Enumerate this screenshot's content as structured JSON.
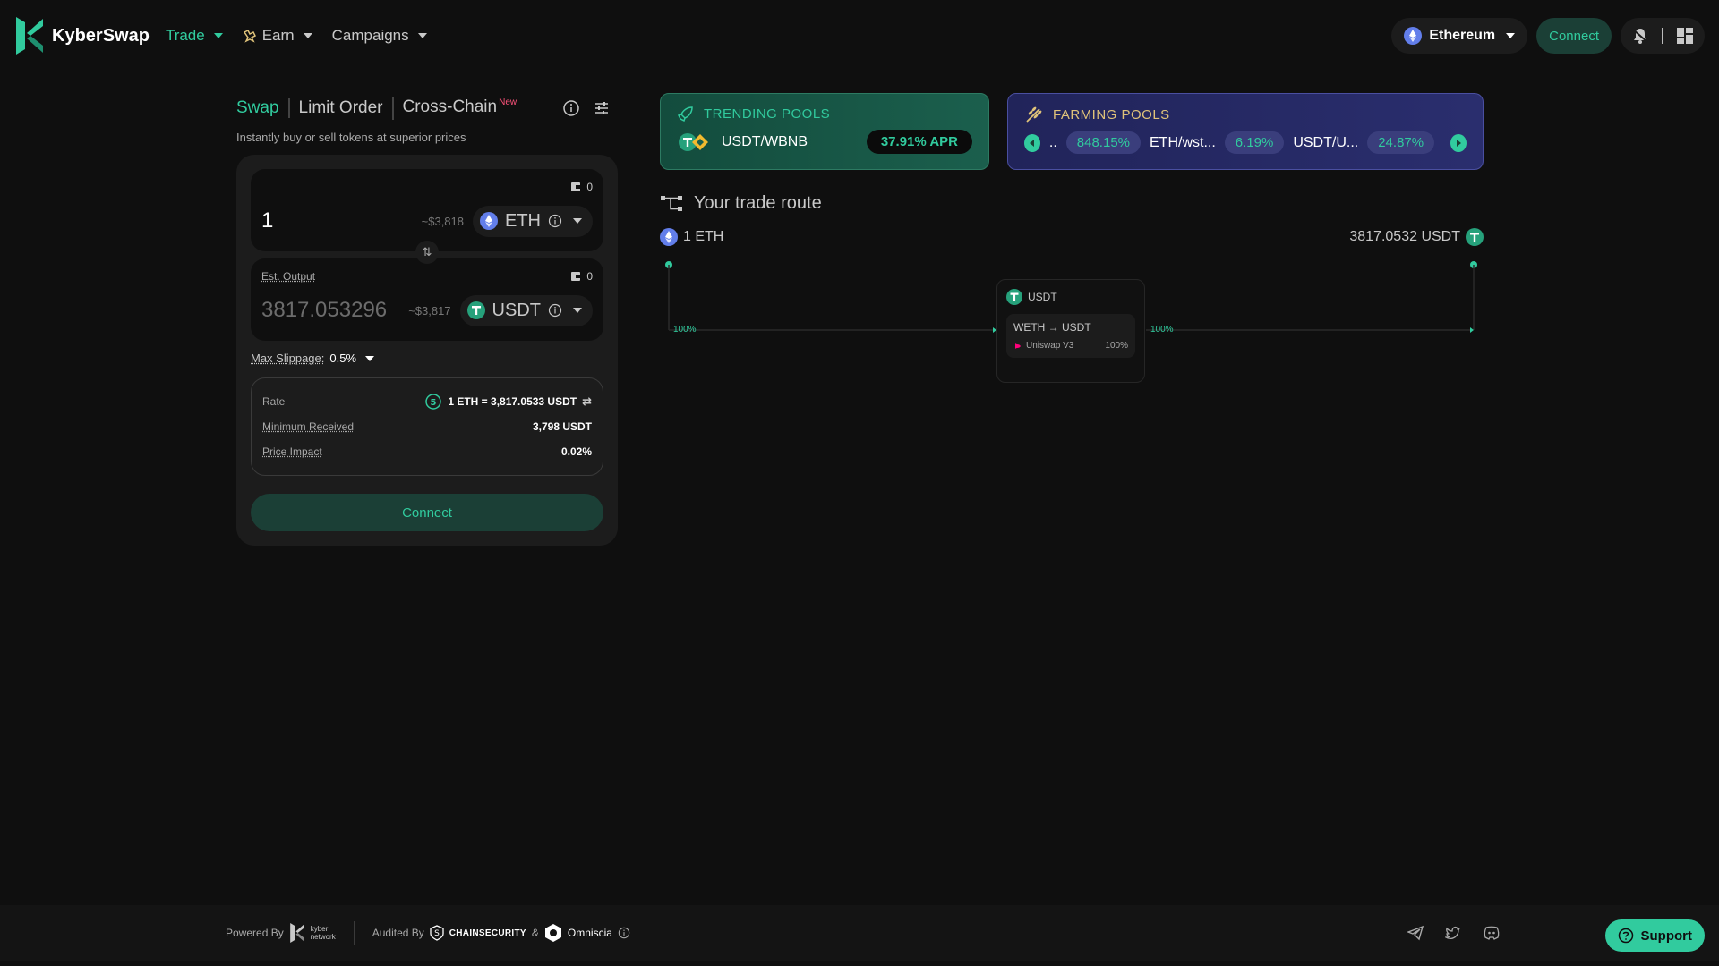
{
  "brand": {
    "name": "KyberSwap"
  },
  "nav": {
    "items": [
      {
        "label": "Trade",
        "active": true
      },
      {
        "label": "Earn",
        "active": false
      },
      {
        "label": "Campaigns",
        "active": false
      }
    ]
  },
  "header": {
    "network": "Ethereum",
    "connect_label": "Connect"
  },
  "swap": {
    "tabs": [
      {
        "label": "Swap",
        "active": true
      },
      {
        "label": "Limit Order",
        "active": false
      },
      {
        "label": "Cross-Chain",
        "active": false,
        "badge": "New"
      }
    ],
    "subtitle": "Instantly buy or sell tokens at superior prices",
    "input": {
      "balance": "0",
      "amount": "1",
      "usd": "~$3,818",
      "token": "ETH"
    },
    "output": {
      "label": "Est. Output",
      "balance": "0",
      "amount": "3817.053296",
      "usd": "~$3,817",
      "token": "USDT"
    },
    "slippage": {
      "label": "Max Slippage:",
      "value": "0.5%"
    },
    "info": {
      "rate_label": "Rate",
      "rate_countdown": "5",
      "rate_value": "1 ETH = 3,817.0533 USDT",
      "min_label": "Minimum Received",
      "min_value": "3,798 USDT",
      "impact_label": "Price Impact",
      "impact_value": "0.02%"
    },
    "connect_label": "Connect"
  },
  "trending": {
    "title": "TRENDING POOLS",
    "pair": "USDT/WBNB",
    "apr": "37.91% APR"
  },
  "farming": {
    "title": "FARMING POOLS",
    "items": [
      {
        "name": "..",
        "apr": "848.15%"
      },
      {
        "name": "ETH/wst...",
        "apr": "6.19%"
      },
      {
        "name": "USDT/U...",
        "apr": "24.87%"
      }
    ]
  },
  "route": {
    "title": "Your trade route",
    "from": "1 ETH",
    "to": "3817.0532 USDT",
    "left_pct": "100%",
    "right_pct": "100%",
    "hop": {
      "token": "USDT",
      "pair": "WETH → USDT",
      "dex": "Uniswap V3",
      "dex_pct": "100%"
    }
  },
  "footer": {
    "powered_by": "Powered By",
    "kyber_top": "kyber",
    "kyber_bottom": "network",
    "audited_by": "Audited By",
    "auditor1": "CHAINSECURITY",
    "amp": "&",
    "auditor2": "Omniscia"
  },
  "support_label": "Support",
  "colors": {
    "accent": "#31cb9e",
    "background": "#0f0f0f",
    "card": "#1c1c1c",
    "eth": "#627eea",
    "usdt": "#26a17b",
    "bnb": "#f3ba2f",
    "new_badge": "#ff537b"
  }
}
